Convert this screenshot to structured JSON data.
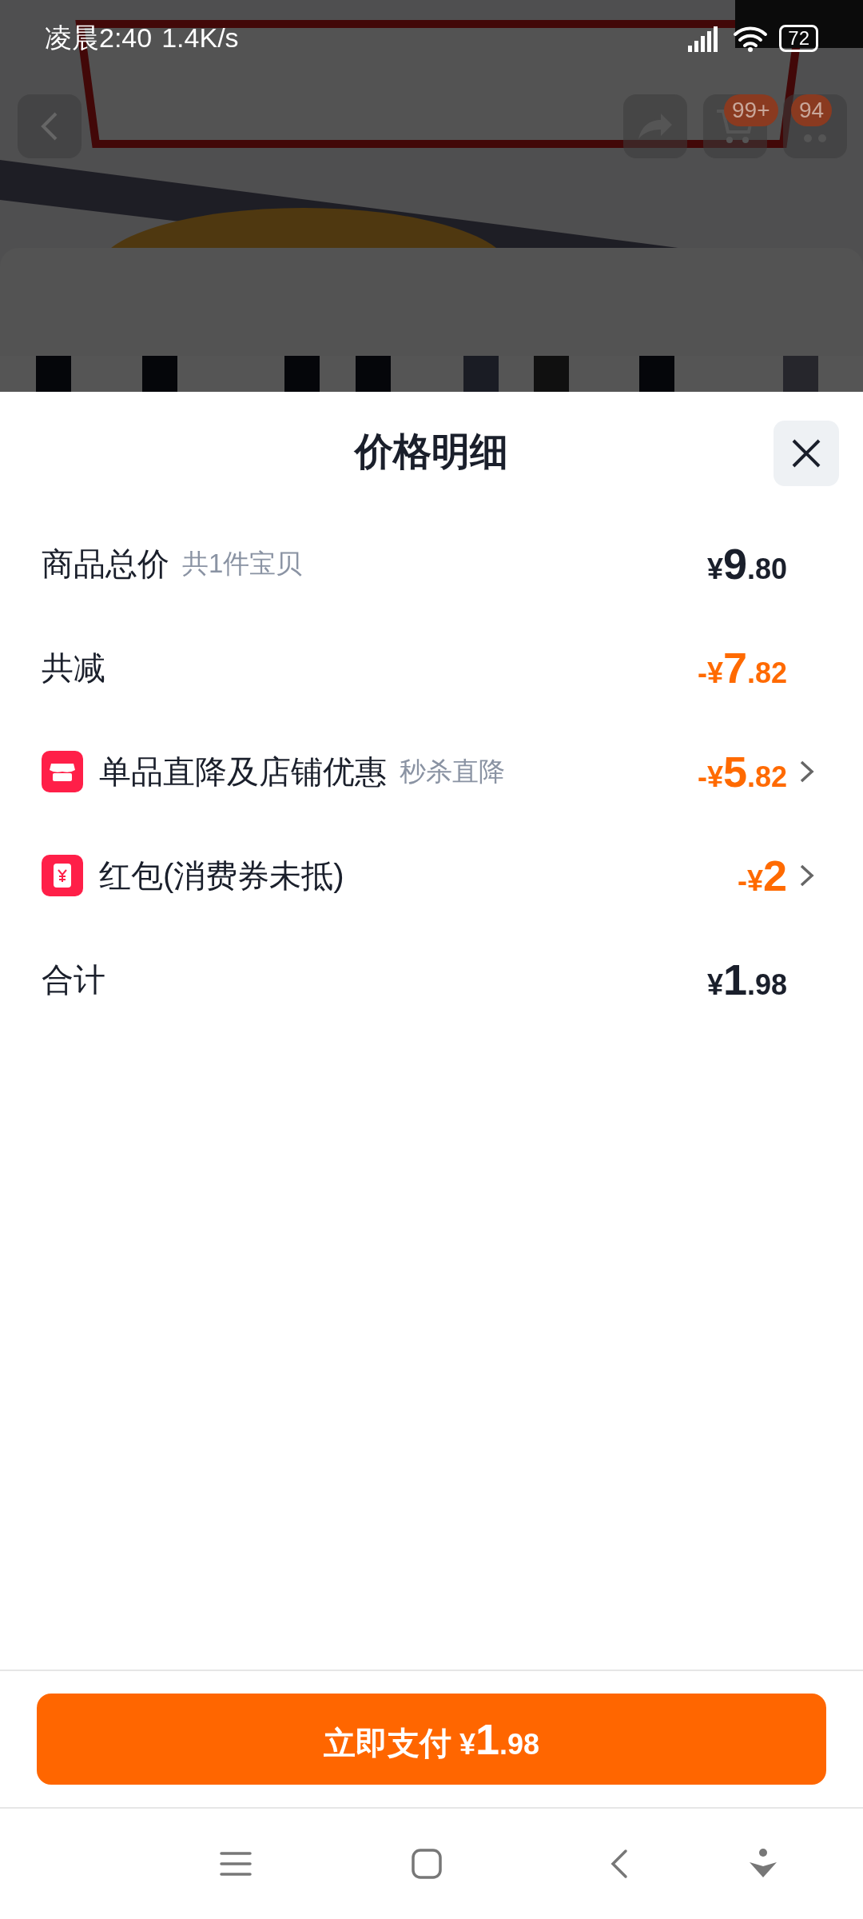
{
  "status_bar": {
    "time": "凌晨2:40",
    "speed": "1.4K/s",
    "battery": "72"
  },
  "header": {
    "cart_badge": "99+",
    "message_badge": "94"
  },
  "sheet": {
    "title": "价格明细",
    "rows": [
      {
        "kind": "plain",
        "label": "商品总价",
        "note": "共1件宝贝",
        "amount": "¥9.80",
        "discount": false,
        "has_detail": false
      },
      {
        "kind": "plain",
        "label": "共减",
        "amount": "-¥7.82",
        "discount": true,
        "has_detail": false
      },
      {
        "kind": "store",
        "label": "单品直降及店铺优惠",
        "note": "秒杀直降",
        "amount": "-¥5.82",
        "discount": true,
        "has_detail": true
      },
      {
        "kind": "coupon",
        "label": "红包(消费券未抵)",
        "amount": "-¥2",
        "discount": true,
        "has_detail": true
      },
      {
        "kind": "plain",
        "label": "合计",
        "amount": "¥1.98",
        "discount": false,
        "has_detail": false
      }
    ]
  },
  "pay_button": {
    "label": "立即支付",
    "amount": "¥1.98"
  }
}
